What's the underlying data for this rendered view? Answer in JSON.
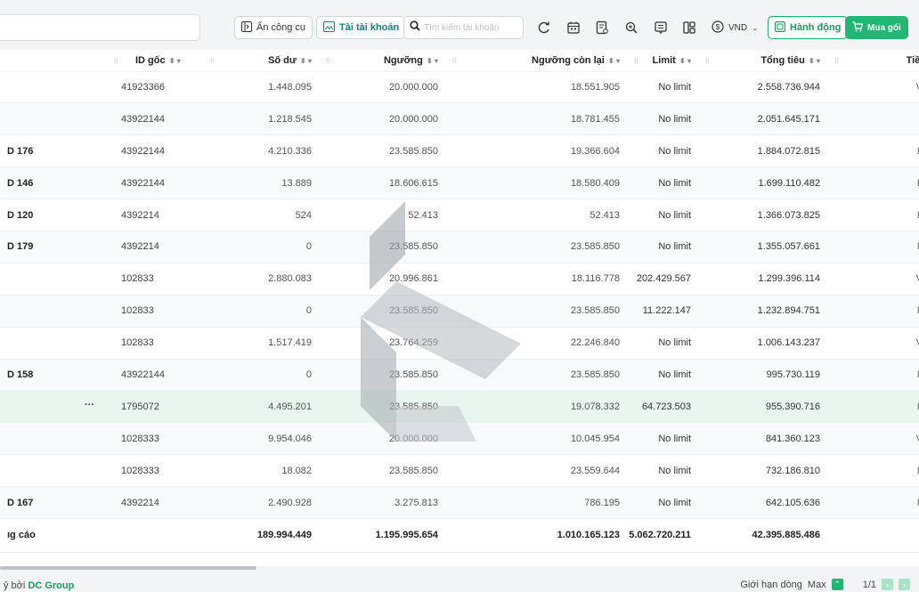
{
  "toolbar": {
    "hide_tools": "Ẩn công cụ",
    "accounts": "Tài tài khoản",
    "search_placeholder": "Tìm kiếm tài khoản",
    "currency": "VND",
    "actions": "Hành động",
    "buy": "Mua gói"
  },
  "columns": {
    "id": "ID gốc",
    "balance": "Số dư",
    "threshold": "Ngưỡng",
    "remaining": "Ngưỡng còn lại",
    "limit": "Limit",
    "total": "Tổng tiêu",
    "money": "Tiền"
  },
  "rows": [
    {
      "name": "",
      "id": "41923366",
      "balance": "1.448.095",
      "threshold": "20.000.000",
      "remaining": "18.551.905",
      "limit": "No limit",
      "total": "2.558.736.944",
      "tien": "V"
    },
    {
      "name": "",
      "id": "43922144",
      "balance": "1.218.545",
      "threshold": "20.000.000",
      "remaining": "18.781.455",
      "limit": "No limit",
      "total": "2.051.645.171",
      "tien": ""
    },
    {
      "name": "D 176",
      "id": "43922144",
      "balance": "4.210.336",
      "threshold": "23.585.850",
      "remaining": "19.366.604",
      "limit": "No limit",
      "total": "1.884.072.815",
      "tien": "L"
    },
    {
      "name": "D 146",
      "id": "43922144",
      "balance": "13.889",
      "threshold": "18.606.615",
      "remaining": "18.580.409",
      "limit": "No limit",
      "total": "1.699.110.482",
      "tien": "L"
    },
    {
      "name": "D 120",
      "id": "4392214",
      "balance": "524",
      "threshold": "52.413",
      "remaining": "52.413",
      "limit": "No limit",
      "total": "1.366.073.825",
      "tien": "L"
    },
    {
      "name": "D 179",
      "id": "4392214",
      "balance": "0",
      "threshold": "23.585.850",
      "remaining": "23.585.850",
      "limit": "No limit",
      "total": "1.355.057.661",
      "tien": "L"
    },
    {
      "name": "",
      "id": "102833",
      "balance": "2.880.083",
      "threshold": "20.996.861",
      "remaining": "18.116.778",
      "limit": "202.429.567",
      "total": "1.299.396.114",
      "tien": "V"
    },
    {
      "name": "",
      "id": "102833",
      "balance": "0",
      "threshold": "23.585.850",
      "remaining": "23.585.850",
      "limit": "11.222.147",
      "total": "1.232.894.751",
      "tien": "L"
    },
    {
      "name": "",
      "id": "102833",
      "balance": "1.517.419",
      "threshold": "23.764.259",
      "remaining": "22.246.840",
      "limit": "No limit",
      "total": "1.006.143.237",
      "tien": "V"
    },
    {
      "name": "D 158",
      "id": "43922144",
      "balance": "0",
      "threshold": "23.585.850",
      "remaining": "23.585.850",
      "limit": "No limit",
      "total": "995.730.119",
      "tien": "L"
    },
    {
      "name": "",
      "id": "1795072",
      "balance": "4.495.201",
      "threshold": "23.585.850",
      "remaining": "19.078.332",
      "limit": "64.723.503",
      "total": "955.390.716",
      "tien": "L",
      "menu": "···"
    },
    {
      "name": "",
      "id": "1028333",
      "balance": "9.954.046",
      "threshold": "20.000.000",
      "remaining": "10.045.954",
      "limit": "No limit",
      "total": "841.360.123",
      "tien": "V"
    },
    {
      "name": "",
      "id": "1028333",
      "balance": "18.082",
      "threshold": "23.585.850",
      "remaining": "23.559.644",
      "limit": "No limit",
      "total": "732.186.810",
      "tien": "L"
    },
    {
      "name": "D 167",
      "id": "4392214",
      "balance": "2.490.928",
      "threshold": "3.275.813",
      "remaining": "786.195",
      "limit": "No limit",
      "total": "642.105.636",
      "tien": "L"
    }
  ],
  "totals": {
    "label": "ıg cáo",
    "balance": "189.994.449",
    "threshold": "1.195.995.654",
    "remaining": "1.010.165.123",
    "limit": "5.062.720.211",
    "total": "42.395.885.486"
  },
  "footer": {
    "prefix": "ỷ bởi",
    "brand": "DC Group",
    "row_limit": "Giới hạn dòng",
    "max": "Max",
    "pages": "1/1"
  }
}
